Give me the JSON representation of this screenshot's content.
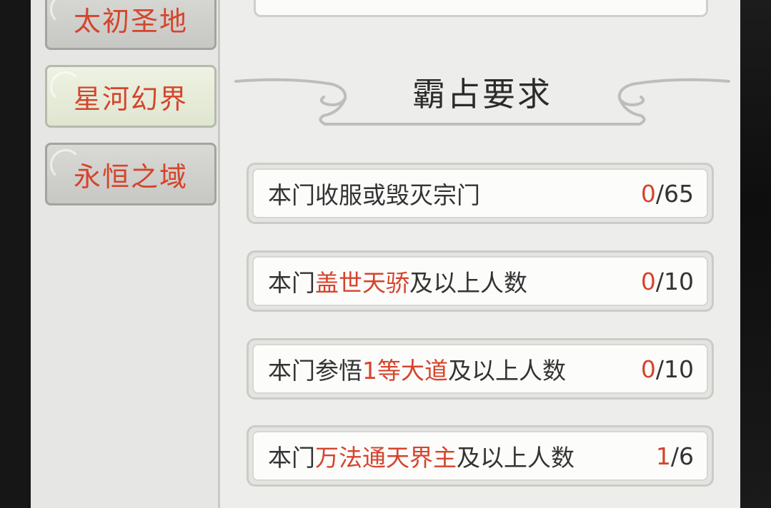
{
  "sidebar": {
    "items": [
      {
        "label": "太初圣地",
        "active": false
      },
      {
        "label": "星河幻界",
        "active": true
      },
      {
        "label": "永恒之域",
        "active": false
      }
    ]
  },
  "section": {
    "title": "霸占要求"
  },
  "requirements": [
    {
      "prefix": "本门收服或毁灭宗门",
      "highlight": "",
      "suffix": "",
      "current": "0",
      "total": "/65"
    },
    {
      "prefix": "本门",
      "highlight": "盖世天骄",
      "suffix": "及以上人数",
      "current": "0",
      "total": "/10"
    },
    {
      "prefix": "本门参悟",
      "highlight": "1等大道",
      "suffix": "及以上人数",
      "current": "0",
      "total": "/10"
    },
    {
      "prefix": "本门",
      "highlight": "万法通天界主",
      "suffix": "及以上人数",
      "current": "1",
      "total": "/6"
    }
  ],
  "colors": {
    "highlight": "#d5442c",
    "panel": "#ededeb",
    "text": "#333333"
  }
}
